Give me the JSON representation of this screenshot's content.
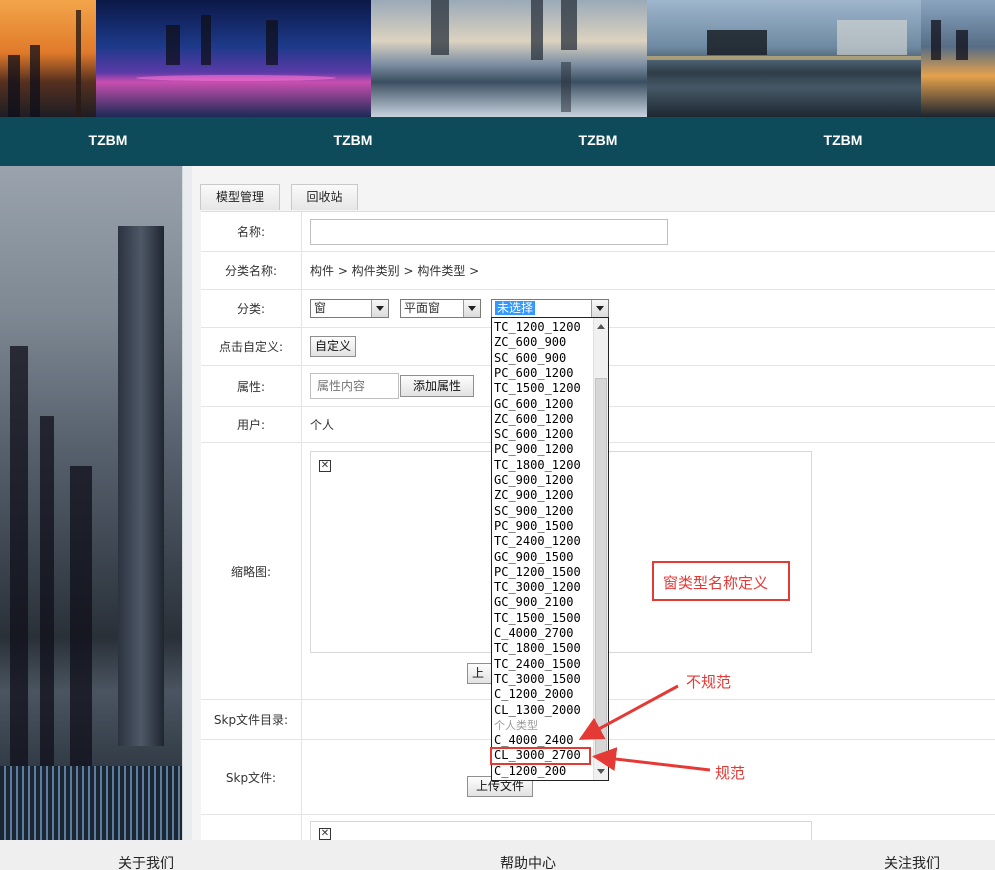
{
  "nav": {
    "items": [
      "TZBM",
      "TZBM",
      "TZBM",
      "TZBM"
    ]
  },
  "tabs": [
    "模型管理",
    "回收站"
  ],
  "form": {
    "name_label": "名称:",
    "name_value": "",
    "category_name_label": "分类名称:",
    "category_path": "构件 > 构件类别 > 构件类型 >",
    "category_label": "分类:",
    "select1": "窗",
    "select2": "平面窗",
    "select3": "未选择",
    "custom_label": "点击自定义:",
    "custom_button": "自定义",
    "attr_label": "属性:",
    "attr_placeholder": "属性内容",
    "add_attr_button": "添加属性",
    "user_label": "用户:",
    "user_value": "个人",
    "thumb_label": "缩略图:",
    "upload_fragment": "上",
    "skp_dir_label": "Skp文件目录:",
    "skp_file_label": "Skp文件:",
    "upload_file_button": "上传文件"
  },
  "dropdown": {
    "options": [
      "TC_1200_1200",
      "ZC_600_900",
      "SC_600_900",
      "PC_600_1200",
      "TC_1500_1200",
      "GC_600_1200",
      "ZC_600_1200",
      "SC_600_1200",
      "PC_900_1200",
      "TC_1800_1200",
      "GC_900_1200",
      "ZC_900_1200",
      "SC_900_1200",
      "PC_900_1500",
      "TC_2400_1200",
      "GC_900_1500",
      "PC_1200_1500",
      "TC_3000_1200",
      "GC_900_2100",
      "TC_1500_1500",
      "C_4000_2700",
      "TC_1800_1500",
      "TC_2400_1500",
      "TC_3000_1500",
      "C_1200_2000",
      "CL_1300_2000"
    ],
    "group_label": "个人类型",
    "personal_options": [
      "C_4000_2400",
      "CL_3000_2700",
      "C_1200_200"
    ]
  },
  "annotations": {
    "definition": "窗类型名称定义",
    "nonstandard": "不规范",
    "standard": "规范",
    "color": "#e53935"
  },
  "footer": {
    "about": "关于我们",
    "help": "帮助中心",
    "follow": "关注我们"
  }
}
